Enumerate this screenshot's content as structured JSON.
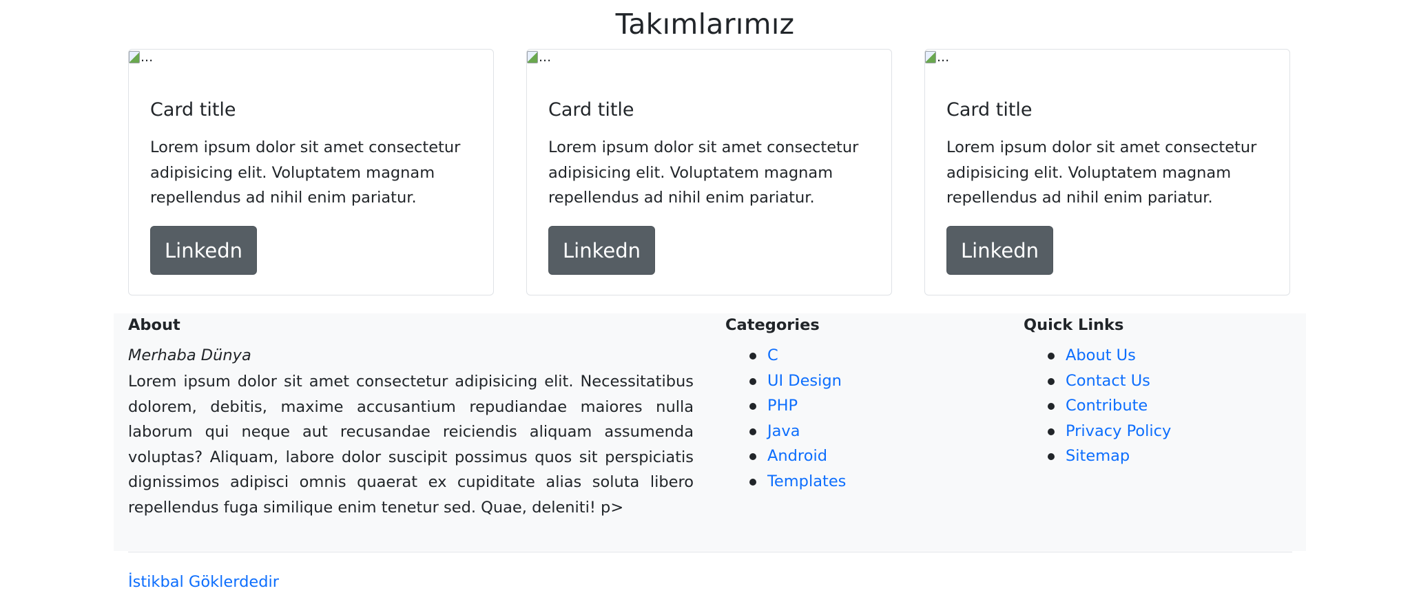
{
  "section": {
    "title": "Takımlarımız"
  },
  "cards": [
    {
      "img_alt": "...",
      "title": "Card title",
      "text": "Lorem ipsum dolor sit amet consectetur adipisicing elit. Voluptatem magnam repellendus ad nihil enim pariatur.",
      "button": "Linkedn"
    },
    {
      "img_alt": "...",
      "title": "Card title",
      "text": "Lorem ipsum dolor sit amet consectetur adipisicing elit. Voluptatem magnam repellendus ad nihil enim pariatur.",
      "button": "Linkedn"
    },
    {
      "img_alt": "...",
      "title": "Card title",
      "text": "Lorem ipsum dolor sit amet consectetur adipisicing elit. Voluptatem magnam repellendus ad nihil enim pariatur.",
      "button": "Linkedn"
    }
  ],
  "footer": {
    "about": {
      "heading": "About",
      "emphasis": "Merhaba Dünya",
      "text": "Lorem ipsum dolor sit amet consectetur adipisicing elit. Necessitatibus dolorem, debitis, maxime accusantium repudiandae maiores nulla laborum qui neque aut recusandae reiciendis aliquam assumenda voluptas? Aliquam, labore dolor suscipit possimus quos sit perspiciatis dignissimos adipisci omnis quaerat ex cupiditate alias soluta libero repellendus fuga similique enim tenetur sed. Quae, deleniti! p>"
    },
    "categories": {
      "heading": "Categories",
      "items": [
        "C",
        "UI Design",
        "PHP",
        "Java",
        "Android",
        "Templates"
      ]
    },
    "quick_links": {
      "heading": "Quick Links",
      "items": [
        "About Us",
        "Contact Us",
        "Contribute",
        "Privacy Policy",
        "Sitemap"
      ]
    },
    "bottom_link": "İstikbal Göklerdedir"
  },
  "colors": {
    "link": "#0d6efd",
    "button_bg": "#565e64",
    "footer_bg": "#f8f9fa",
    "text": "#212529"
  }
}
